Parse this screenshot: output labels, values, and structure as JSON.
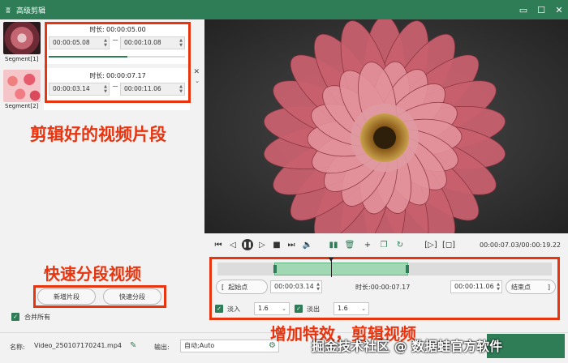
{
  "titlebar": {
    "title": "高级剪辑",
    "logo_icon": "bunny-logo-icon",
    "restore_icon": "restore-icon",
    "maximize_icon": "maximize-icon",
    "close_icon": "close-icon"
  },
  "segments": [
    {
      "label": "Segment[1]",
      "duration_label": "时长:",
      "duration": "00:00:05.00",
      "start": "00:00:05.08",
      "end": "00:00:10.08",
      "progress": 0.58
    },
    {
      "label": "Segment[2]",
      "duration_label": "时长:",
      "duration": "00:00:07.17",
      "start": "00:00:03.14",
      "end": "00:00:11.06"
    }
  ],
  "annotations": {
    "segments_note": "剪辑好的视频片段",
    "quick_note": "快速分段视频",
    "effects_note": "增加特效，剪辑视频"
  },
  "left_buttons": {
    "add_segment": "新增片段",
    "quick_split": "快速分段"
  },
  "merge_all": {
    "label": "合并所有",
    "checked": true
  },
  "player": {
    "time": "00:00:07.03/00:00:19.22"
  },
  "trim": {
    "start_point": "起始点",
    "start_value": "00:00:03.14",
    "duration_label": "时长:",
    "duration": "00:00:07.17",
    "end_value": "00:00:11.06",
    "end_point": "结束点",
    "selection_start": 0.17,
    "selection_end": 0.57,
    "playhead": 0.34
  },
  "fade": {
    "fade_in_label": "淡入",
    "fade_in_value": "1.6",
    "fade_out_label": "淡出",
    "fade_out_value": "1.6"
  },
  "bottom": {
    "name_label": "名称:",
    "name_value": "Video_250107170241.mp4",
    "output_label": "输出:",
    "output_value": "自动;Auto",
    "watermark": "掘金技术社区 @ 数据蛙官方软件"
  },
  "colors": {
    "brand": "#2e7d57",
    "annotation": "#e8340f"
  }
}
